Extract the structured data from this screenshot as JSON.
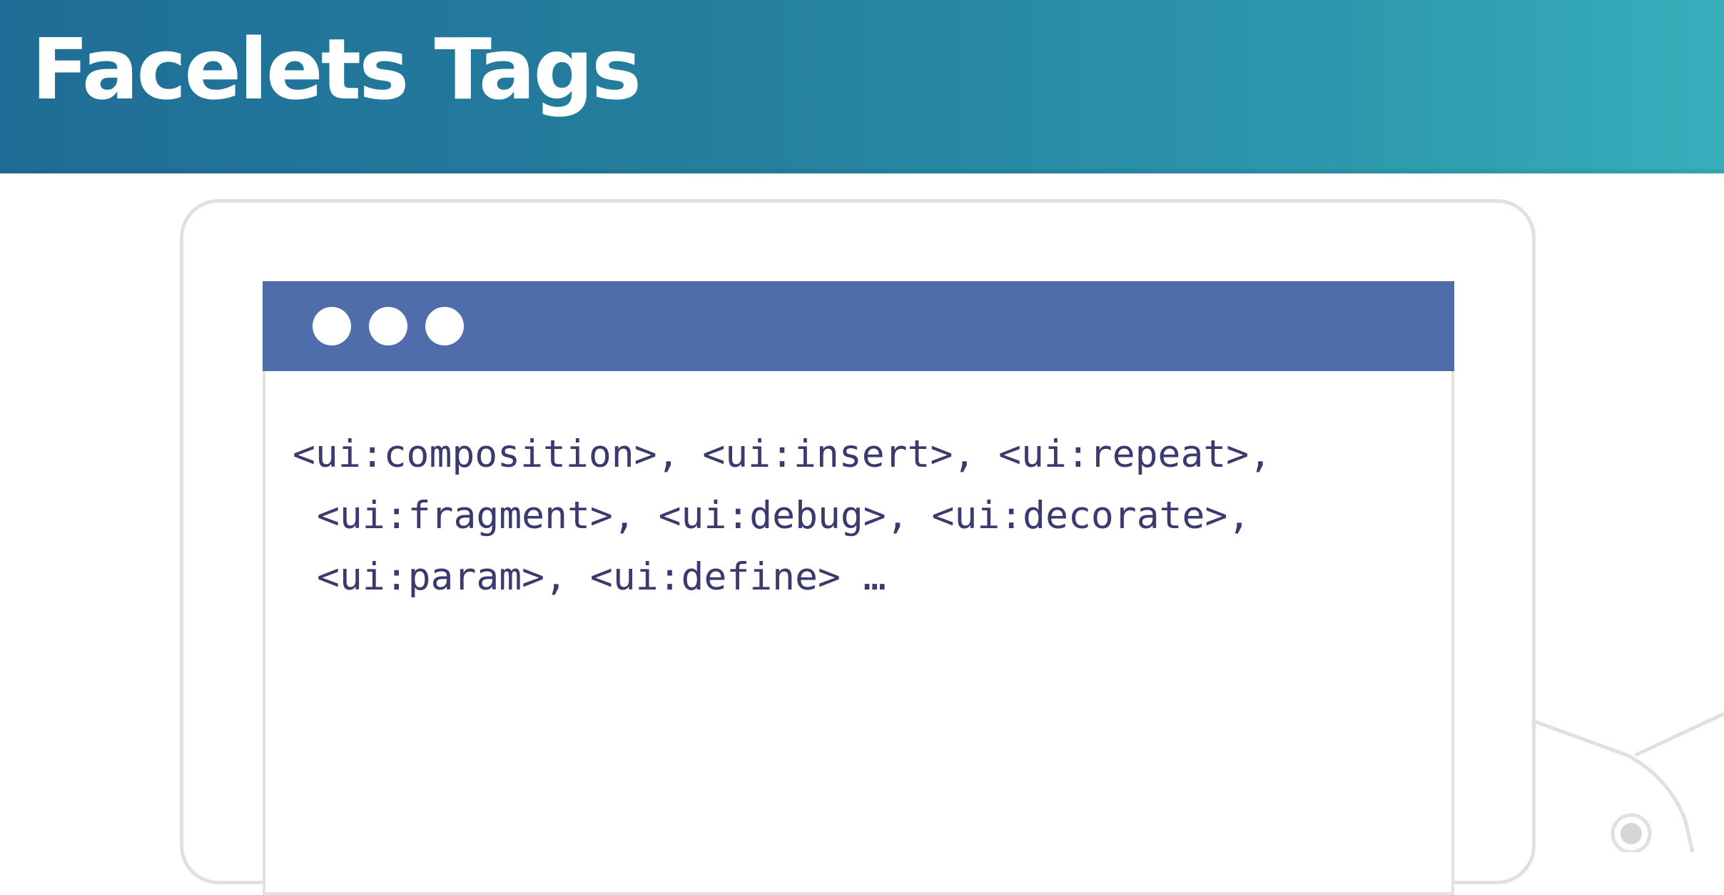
{
  "slide": {
    "title": "Facelets Tags"
  },
  "colors": {
    "header_gradient_start": "#1f6d96",
    "header_gradient_end": "#37afbb",
    "browser_titlebar": "#4f6dab",
    "code_text": "#3b3a6e",
    "frame_border": "#e2e0dc"
  },
  "browser": {
    "controls": [
      "window-dot-icon",
      "window-dot-icon",
      "window-dot-icon"
    ],
    "code_lines": [
      "<ui:composition>, <ui:insert>, <ui:repeat>,",
      "<ui:fragment>, <ui:debug>, <ui:decorate>,",
      "<ui:param>, <ui:define> …"
    ]
  }
}
